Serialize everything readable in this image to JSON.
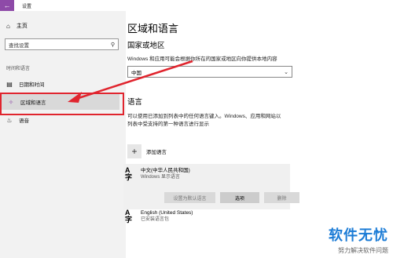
{
  "window": {
    "title": "设置",
    "back_icon": "back-arrow-icon"
  },
  "sidebar": {
    "home_label": "主页",
    "search_placeholder": "查找设置",
    "group_label": "时间和语言",
    "items": [
      {
        "label": "日期和时间",
        "icon": "clock-calendar-icon"
      },
      {
        "label": "区域和语言",
        "icon": "region-icon",
        "selected": true
      },
      {
        "label": "语音",
        "icon": "microphone-icon"
      }
    ]
  },
  "main": {
    "title": "区域和语言",
    "country": {
      "heading": "国家或地区",
      "description": "Windows 和应用可能会根据你所在的国家或地区向你提供本地内容",
      "selected": "中国"
    },
    "language": {
      "heading": "语言",
      "description": "可以使用已添加到列表中的任何语言键入。Windows、应用和网站以列表中受支持的第一种语言进行显示",
      "add_label": "添加语言",
      "items": [
        {
          "name": "中文(中华人民共和国)",
          "sub": "Windows 显示语言"
        },
        {
          "name": "English (United States)",
          "sub": "已安装语言包"
        }
      ],
      "buttons": {
        "set_default": "设置为默认语言",
        "options": "选项",
        "remove": "删除"
      }
    }
  },
  "watermark": {
    "main": "软件无忧",
    "sub": "努力解决软件问题"
  },
  "colors": {
    "accent": "#8e4aa8",
    "highlight": "#e0252e",
    "watermark": "#1c7cd6"
  }
}
